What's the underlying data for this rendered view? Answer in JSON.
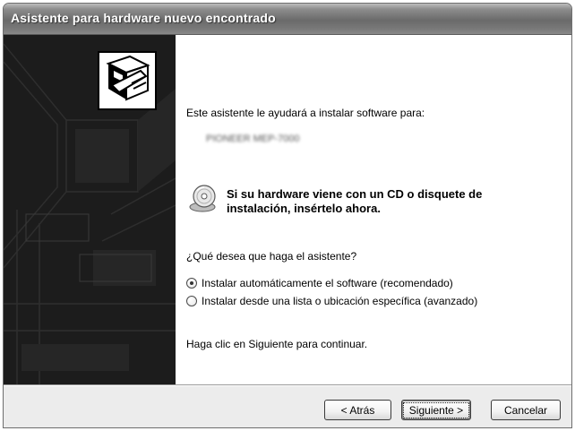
{
  "window": {
    "title": "Asistente para hardware nuevo encontrado"
  },
  "content": {
    "intro": "Este asistente le ayudará a instalar software para:",
    "device_name": "PIONEER MEP-7000",
    "cd_prompt": "Si su hardware viene con un CD o disquete de instalación, insértelo ahora.",
    "question": "¿Qué desea que haga el asistente?",
    "options": [
      {
        "label": "Instalar automáticamente el software (recomendado)",
        "selected": true
      },
      {
        "label": "Instalar desde una lista o ubicación específica (avanzado)",
        "selected": false
      }
    ],
    "continue_hint": "Haga clic en Siguiente para continuar."
  },
  "buttons": {
    "back": "< Atrás",
    "next": "Siguiente >",
    "cancel": "Cancelar"
  },
  "icons": {
    "wizard": "hardware-box-icon",
    "cd": "cd-disc-icon"
  }
}
